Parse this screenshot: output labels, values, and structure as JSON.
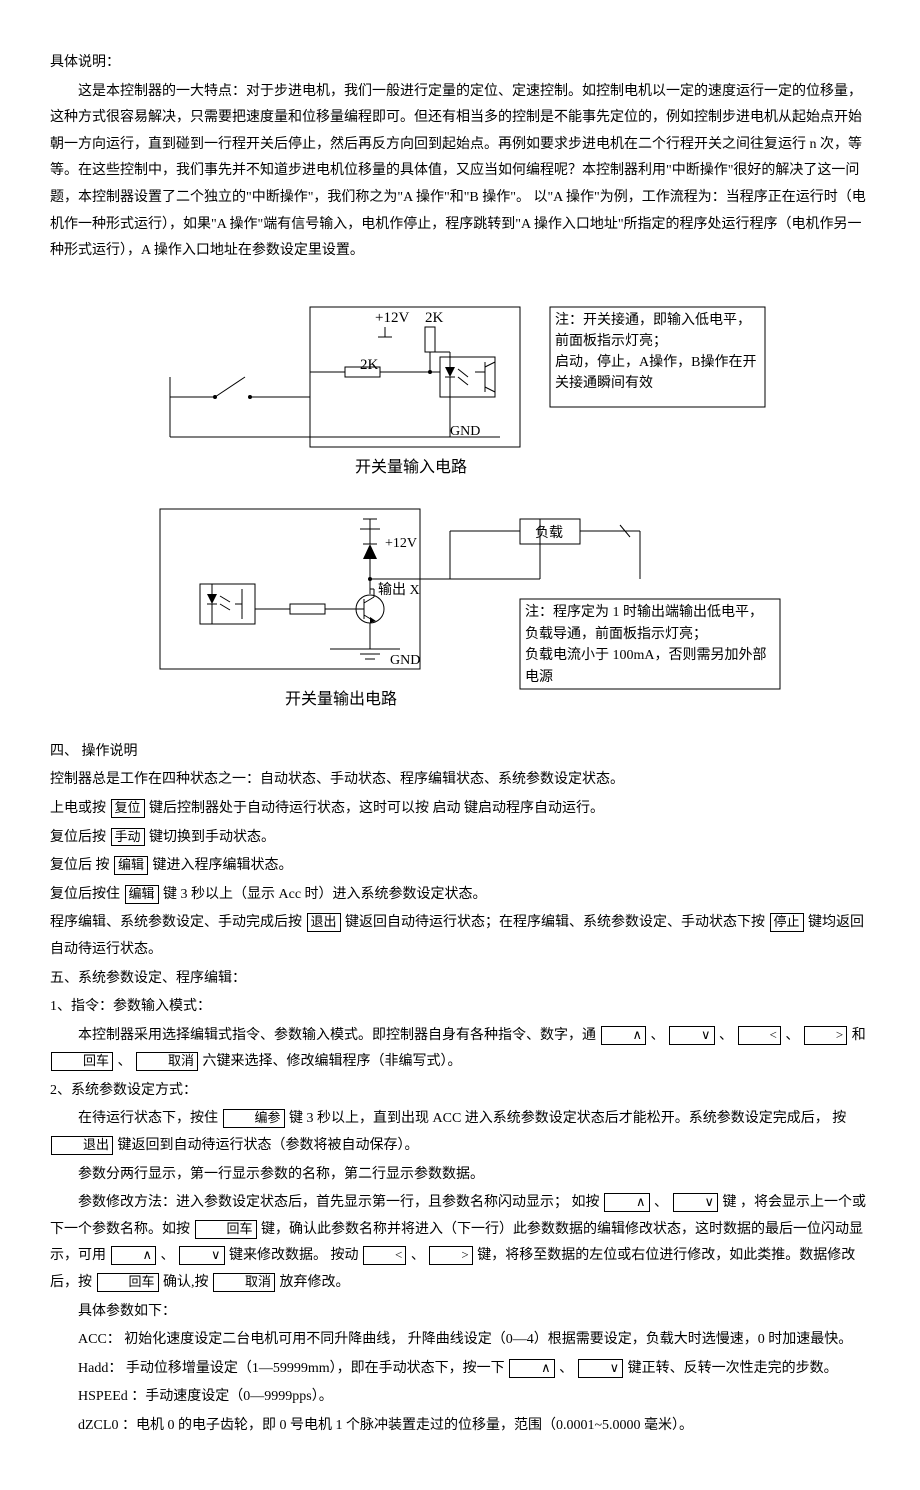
{
  "heading_detail": "具体说明：",
  "intro_p1": "这是本控制器的一大特点：对于步进电机，我们一般进行定量的定位、定速控制。如控制电机以一定的速度运行一定的位移量，这种方式很容易解决，只需要把速度量和位移量编程即可。但还有相当多的控制是不能事先定位的，例如控制步进电机从起始点开始朝一方向运行，直到碰到一行程开关后停止，然后再反方向回到起始点。再例如要求步进电机在二个行程开关之间往复运行 n 次，等等。在这些控制中，我们事先并不知道步进电机位移量的具体值，又应当如何编程呢？本控制器利用\"中断操作\"很好的解决了这一问题，本控制器设置了二个独立的\"中断操作\"，我们称之为\"A 操作\"和\"B 操作\"。 以\"A 操作\"为例，工作流程为：当程序正在运行时（电机作一种形式运行），如果\"A 操作\"端有信号输入，电机作停止，程序跳转到\"A 操作入口地址\"所指定的程序处运行程序（电机作另一种形式运行），A 操作入口地址在参数设定里设置。",
  "diag1": {
    "lbl_12v": "+12V",
    "lbl_2k_a": "2K",
    "lbl_2k_b": "2K",
    "lbl_gnd": "GND",
    "caption": "开关量输入电路",
    "note_l1": "注：开关接通，即输入低电平，前面板指示灯亮；",
    "note_l2": "启动，停止，A操作，B操作在开关接通瞬间有效"
  },
  "diag2": {
    "lbl_12v": "+12V",
    "lbl_outx": "输出 X",
    "lbl_gnd": "GND",
    "lbl_load": "负载",
    "caption": "开关量输出电路",
    "note_l1": "注：程序定为 1 时输出端输出低电平，负载导通，前面板指示灯亮；",
    "note_l2": "负载电流小于 100mA，否则需另加外部电源"
  },
  "sec4_title": "四、 操作说明",
  "s4_l1": "控制器总是工作在四种状态之一：自动状态、手动状态、程序编辑状态、系统参数设定状态。",
  "s4_l2a": "上电或按 ",
  "s4_l2b": " 键后控制器处于自动待运行状态，这时可以按 启动 键启动程序自动运行。",
  "s4_l3a": "复位后按 ",
  "s4_l3b": " 键切换到手动状态。",
  "s4_l4a": "复位后 按 ",
  "s4_l4b": " 键进入程序编辑状态。",
  "s4_l5a": "复位后按住 ",
  "s4_l5b": " 键 3 秒以上（显示 Acc 时）进入系统参数设定状态。",
  "s4_l6a": "程序编辑、系统参数设定、手动完成后按 ",
  "s4_l6b": " 键返回自动待运行状态；在程序编辑、系统参数设定、手动状态下按 ",
  "s4_l6c": " 键均返回自动待运行状态。",
  "sec5_title": "五、系统参数设定、程序编辑：",
  "s5_1_title": "1、指令：参数输入模式：",
  "s5_1_pa": "本控制器采用选择编辑式指令、参数输入模式。即控制器自身有各种指令、数字，通   ",
  "s5_1_pb": " 、  ",
  "s5_1_pc": " 、 ",
  "s5_1_pd": " 、  ",
  "s5_1_pe": " 和   ",
  "s5_1_pf": " 、   ",
  "s5_1_pg": " 六键来选择、修改编辑程序（非编写式）。",
  "s5_2_title": "2、系统参数设定方式：",
  "s5_2_p1a": "在待运行状态下，按住 ",
  "s5_2_p1b": " 键 3 秒以上，直到出现 ACC 进入系统参数设定状态后才能松开。系统参数设定完成后， 按 ",
  "s5_2_p1c": " 键返回到自动待运行状态（参数将被自动保存）。",
  "s5_2_p2": "参数分两行显示，第一行显示参数的名称，第二行显示参数数据。",
  "s5_2_p3a": "参数修改方法：进入参数设定状态后，首先显示第一行，且参数名称闪动显示；  如按 ",
  "s5_2_p3b": " 、  ",
  "s5_2_p3c": " 键 ，将会显示上一个或下一个参数名称。如按 ",
  "s5_2_p3d": " 键，确认此参数名称并将进入（下一行）此参数数据的编辑修改状态，这时数据的最后一位闪动显示，可用 ",
  "s5_2_p3e": " 、 ",
  "s5_2_p3f": " 键来修改数据。 按动 ",
  "s5_2_p3g": " 、 ",
  "s5_2_p3h": " 键，将移至数据的左位或右位进行修改，如此类推。数据修改后，按 ",
  "s5_2_p3i": " 确认,按 ",
  "s5_2_p3j": " 放弃修改。",
  "params_title": "具体参数如下：",
  "param_acc": "ACC：  初始化速度设定二台电机可用不同升降曲线，  升降曲线设定（0—4）根据需要设定，负载大时选慢速，0 时加速最快。",
  "param_hadd_a": "Hadd：  手动位移增量设定（1—59999mm），即在手动状态下，按一下 ",
  "param_hadd_b": " 、  ",
  "param_hadd_c": " 键正转、反转一次性走完的步数。",
  "param_hspeed": "HSPEEd ：手动速度设定（0—9999pps）。",
  "param_dzcl0": "dZCL0 ：电机 0 的电子齿轮，即 0 号电机 1 个脉冲装置走过的位移量，范围（0.0001~5.0000 毫米）。",
  "keys": {
    "reset": "复位",
    "manual": "手动",
    "edit": "编辑",
    "exit": "退出",
    "stop": "停止",
    "up": "∧",
    "down": "∨",
    "left": "<",
    "right": ">",
    "enter": "回车",
    "cancel": "取消",
    "editparam": "编参"
  }
}
